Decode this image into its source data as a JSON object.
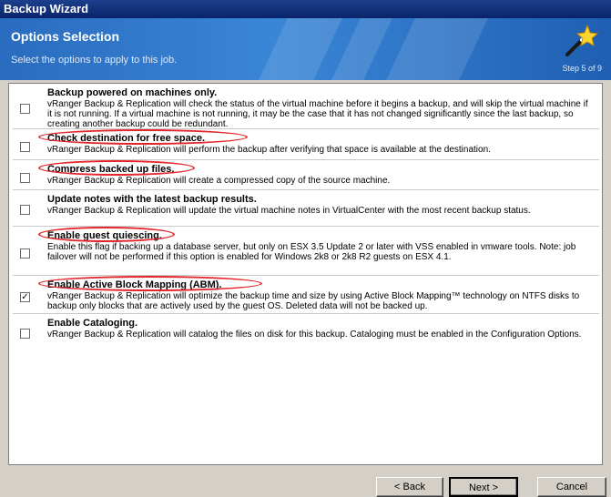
{
  "window": {
    "title": "Backup Wizard"
  },
  "header": {
    "title": "Options Selection",
    "subtitle": "Select the options to apply to this job.",
    "step": "Step 5 of 9",
    "icon": "wizard-wand-icon"
  },
  "options": [
    {
      "title": "Backup powered on machines only.",
      "checked": false,
      "desc": "vRanger Backup & Replication will check the status of the virtual machine before it begins a backup, and will skip the virtual machine if it is not running. If a virtual machine is not running, it may be the case that it has not changed significantly since the last backup, so creating another backup could be redundant."
    },
    {
      "title": "Check destination for free space.",
      "checked": false,
      "desc": "vRanger Backup & Replication will perform the backup after verifying that space is available at the destination."
    },
    {
      "title": "Compress backed up files.",
      "checked": false,
      "desc": "vRanger Backup & Replication will create a compressed copy of the source machine."
    },
    {
      "title": "Update notes with the latest backup results.",
      "checked": false,
      "desc": "vRanger Backup & Replication will update the virtual machine notes in VirtualCenter with the most recent backup status."
    },
    {
      "title": "Enable guest quiescing.",
      "checked": false,
      "desc": "Enable this flag if backing up a database server, but only on ESX 3.5 Update 2 or later with VSS enabled in vmware tools. Note: job failover will not be performed if this option is enabled for Windows 2k8 or 2k8 R2 guests on ESX 4.1."
    },
    {
      "title": "Enable Active Block Mapping (ABM).",
      "checked": true,
      "desc": "vRanger Backup & Replication will optimize the backup time and size by using Active Block Mapping™ technology on NTFS disks to backup only blocks that are actively used by the guest OS. Deleted data will not be backed up."
    },
    {
      "title": "Enable Cataloging.",
      "checked": false,
      "desc": "vRanger Backup & Replication will catalog the files on disk for this backup. Cataloging must be enabled in the Configuration Options."
    }
  ],
  "buttons": {
    "back": "< Back",
    "next": "Next >",
    "cancel": "Cancel"
  },
  "colors": {
    "header": "#2a6cbf",
    "annotation": "#e3262c"
  }
}
